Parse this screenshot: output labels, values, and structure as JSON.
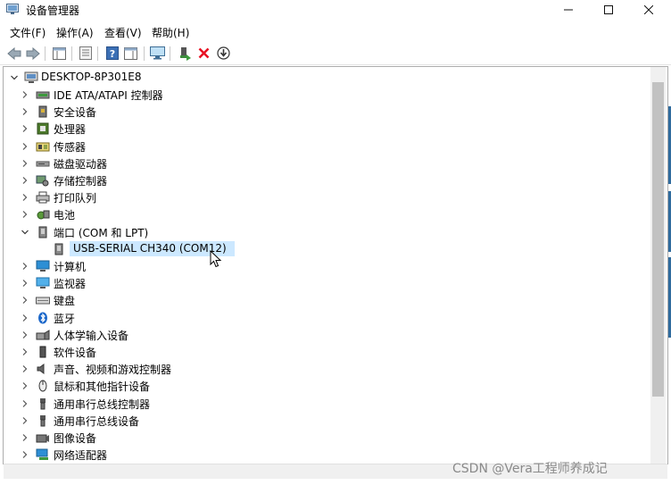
{
  "window": {
    "title": "设备管理器"
  },
  "menu": [
    {
      "label": "文件(F)"
    },
    {
      "label": "操作(A)"
    },
    {
      "label": "查看(V)"
    },
    {
      "label": "帮助(H)"
    }
  ],
  "tree": {
    "root": "DESKTOP-8P301E8",
    "categories": [
      {
        "label": "IDE ATA/ATAPI 控制器",
        "icon": "ide-controller-icon"
      },
      {
        "label": "安全设备",
        "icon": "security-device-icon"
      },
      {
        "label": "处理器",
        "icon": "processor-icon"
      },
      {
        "label": "传感器",
        "icon": "sensor-icon"
      },
      {
        "label": "磁盘驱动器",
        "icon": "disk-drive-icon"
      },
      {
        "label": "存储控制器",
        "icon": "storage-controller-icon"
      },
      {
        "label": "打印队列",
        "icon": "printer-icon"
      },
      {
        "label": "电池",
        "icon": "battery-icon"
      },
      {
        "label": "端口 (COM 和 LPT)",
        "icon": "port-icon",
        "expanded": true
      },
      {
        "label": "计算机",
        "icon": "computer-icon"
      },
      {
        "label": "监视器",
        "icon": "monitor-icon"
      },
      {
        "label": "键盘",
        "icon": "keyboard-icon"
      },
      {
        "label": "蓝牙",
        "icon": "bluetooth-icon"
      },
      {
        "label": "人体学输入设备",
        "icon": "hid-icon"
      },
      {
        "label": "软件设备",
        "icon": "software-device-icon"
      },
      {
        "label": "声音、视频和游戏控制器",
        "icon": "sound-icon"
      },
      {
        "label": "鼠标和其他指针设备",
        "icon": "mouse-icon"
      },
      {
        "label": "通用串行总线控制器",
        "icon": "usb-icon"
      },
      {
        "label": "通用串行总线设备",
        "icon": "usb-icon"
      },
      {
        "label": "图像设备",
        "icon": "camera-icon"
      },
      {
        "label": "网络适配器",
        "icon": "network-adapter-icon"
      }
    ],
    "port_child": {
      "label": "USB-SERIAL CH340 (COM12)",
      "icon": "serial-port-icon"
    }
  },
  "watermark": "CSDN @Vera工程师养成记",
  "colors": {
    "selection": "#cce8ff",
    "accent": "#0078d7",
    "remove": "#e81123"
  }
}
